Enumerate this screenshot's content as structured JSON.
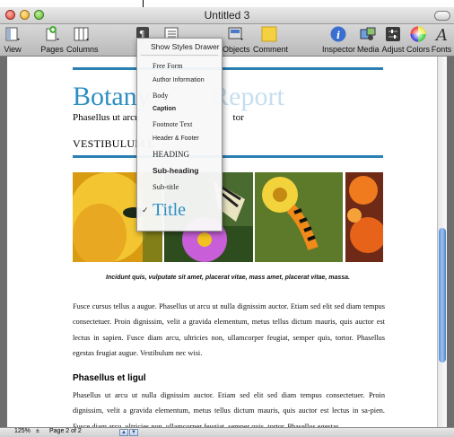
{
  "window": {
    "title": "Untitled 3"
  },
  "toolbar": {
    "view": "View",
    "pages": "Pages",
    "columns": "Columns",
    "objects": "Objects",
    "comment": "Comment",
    "inspector": "Inspector",
    "media": "Media",
    "adjust": "Adjust",
    "colors": "Colors",
    "fonts": "Fonts"
  },
  "styles_menu": {
    "show_drawer": "Show Styles Drawer",
    "items": [
      "Free Form",
      "Author Information",
      "Body",
      "Caption",
      "Footnote Text",
      "Header & Footer",
      "HEADING",
      "Sub-heading",
      "Sub-title",
      "Title"
    ],
    "checked": "Title",
    "checkmark": "✓"
  },
  "document": {
    "title_visible_a": "Botany",
    "title_visible_b": "Report",
    "subtitle_a": "Phasellus ut arcu",
    "subtitle_b": "tor",
    "heading1": "VESTIBULUM L",
    "caption": "Incidunt quis, vulputate sit amet, placerat vitae, mass amet, placerat vitae, massa.",
    "body1": "Fusce cursus tellus a augue. Phasellus ut arcu ut nulla dignissim auctor. Etiam sed elit sed diam tempus consectetuer. Proin dignissim, velit a gravida elementum, metus tellus dictum mauris, quis auctor est lectus in sapien. Fusce diam arcu, ultricies non, ullamcorper feugiat, semper quis, tortor. Phasellus egestas feugiat augue. Vestibulum nec wisi.",
    "heading2": "Phasellus et ligul",
    "body2": "Phasellus ut arcu ut nulla dignissim auctor. Etiam sed elit sed diam tempus consectetuer. Proin dignissim, velit a gravida elementum, metus tellus dictum mauris, quis auctor est lectus in sa-pien. Fusce diam arcu, ultricies non, ullamcorper feugiat, semper quis, tortor. Phasellus egestas"
  },
  "status": {
    "zoom": "125%",
    "page": "Page 2 of 2"
  },
  "colors": {
    "accent_blue": "#2e8fc2",
    "rule_blue": "#2a7fb3",
    "window_gray": "#6e6e6e"
  }
}
